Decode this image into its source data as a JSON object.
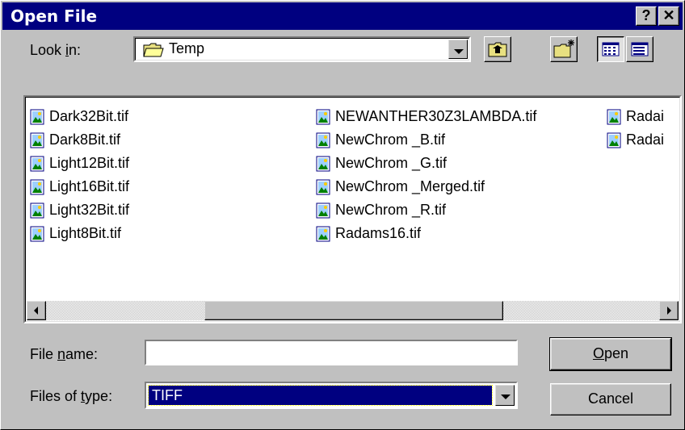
{
  "window": {
    "title": "Open File",
    "help_label": "?",
    "close_label": "✕"
  },
  "look_in": {
    "label_pre": "Look ",
    "label_key": "i",
    "label_post": "n:",
    "value": "Temp"
  },
  "toolbar": {
    "buttons": [
      "up-one-level",
      "create-new-folder",
      "list-view",
      "details-view"
    ]
  },
  "files": {
    "col1": [
      "Dark32Bit.tif",
      "Dark8Bit.tif",
      "Light12Bit.tif",
      "Light16Bit.tif",
      "Light32Bit.tif",
      "Light8Bit.tif"
    ],
    "col2": [
      "NEWANTHER30Z3LAMBDA.tif",
      "NewChrom _B.tif",
      "NewChrom _G.tif",
      "NewChrom _Merged.tif",
      "NewChrom _R.tif",
      "Radams16.tif"
    ],
    "col3": [
      "Radai",
      "Radai"
    ]
  },
  "file_name": {
    "label_pre": "File ",
    "label_key": "n",
    "label_post": "ame:",
    "value": ""
  },
  "file_type": {
    "label_pre": "Files of ",
    "label_key": "t",
    "label_post": "ype:",
    "value": "TIFF"
  },
  "buttons": {
    "open_key": "O",
    "open_rest": "pen",
    "cancel": "Cancel"
  }
}
